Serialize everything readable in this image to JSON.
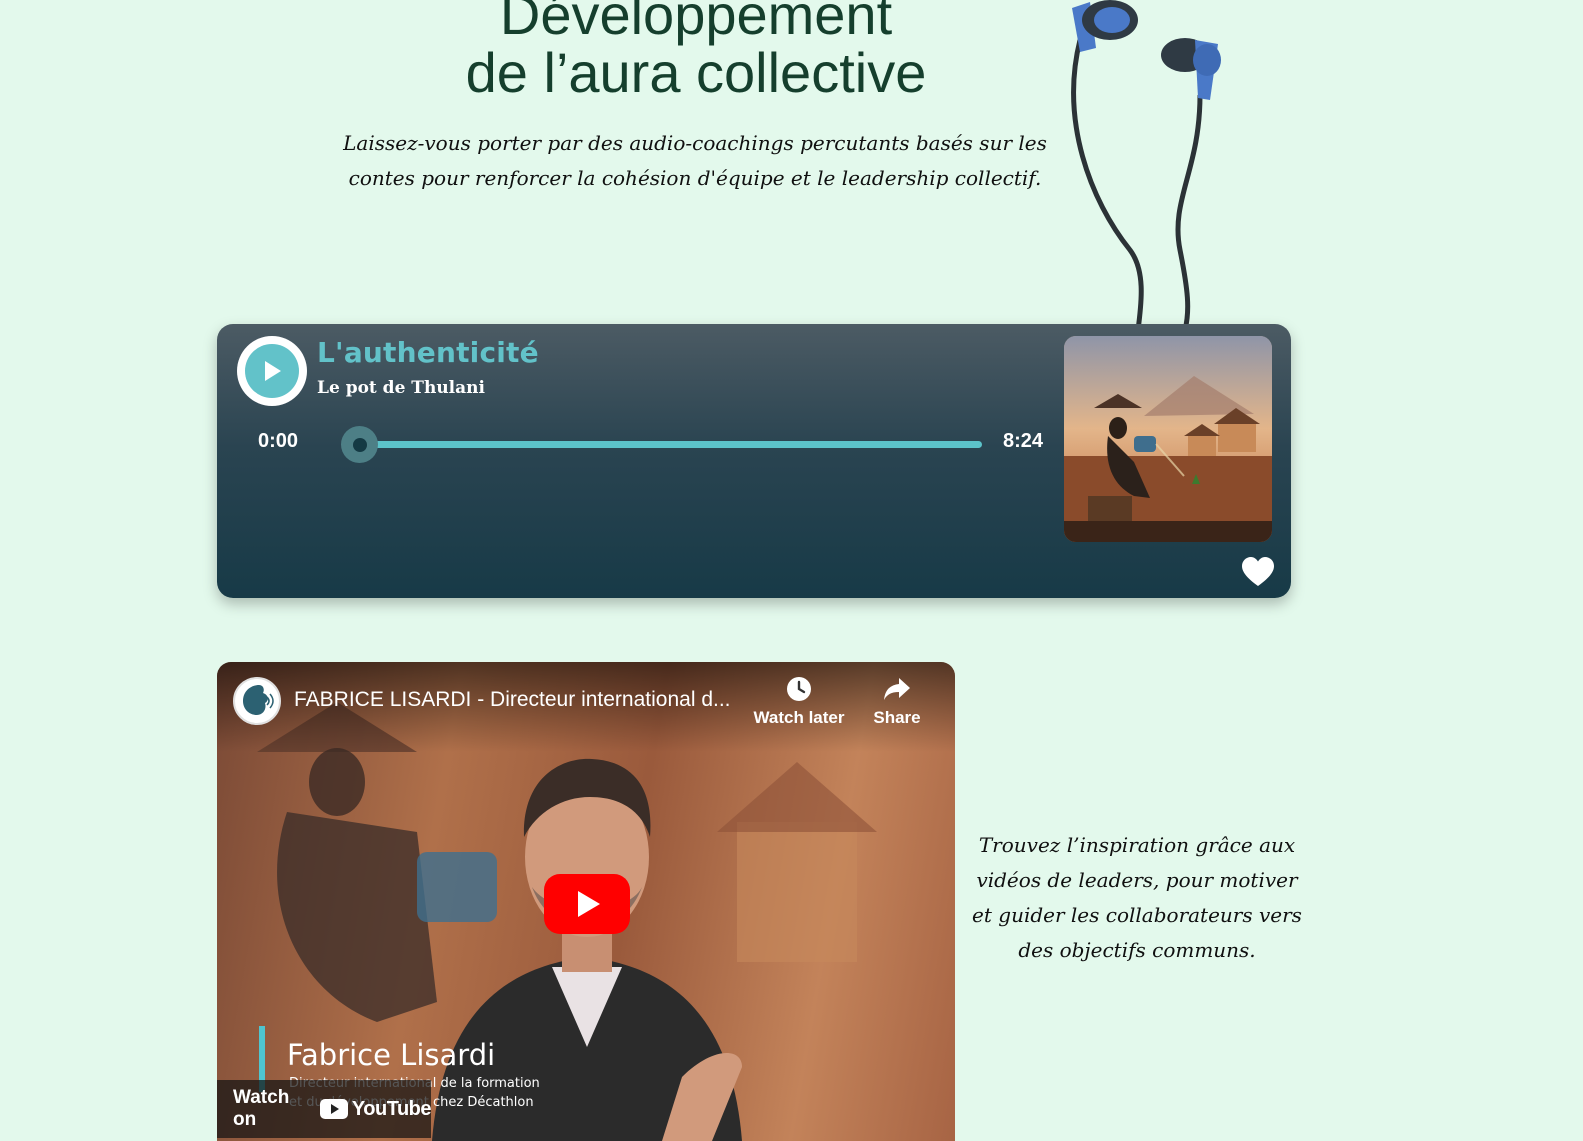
{
  "hero": {
    "title_line1": "Développement",
    "title_line2": "de l’aura collective",
    "subtitle": "Laissez-vous porter par des audio-coachings percutants basés sur les contes pour renforcer la cohésion d'équipe et le leadership collectif."
  },
  "player": {
    "title": "L'authenticité",
    "subtitle": "Le pot de Thulani",
    "time_current": "0:00",
    "time_total": "8:24",
    "progress": 0.0,
    "accent_color": "#62c2c9",
    "play_icon": "play-icon",
    "favorite_icon": "heart-icon"
  },
  "video": {
    "title": "FABRICE LISARDI - Directeur international d...",
    "watch_later_label": "Watch later",
    "share_label": "Share",
    "person_name": "Fabrice Lisardi",
    "person_role_line1": "Directeur international de la formation",
    "person_role_line2": "et du développement chez Décathlon",
    "watch_on_label": "Watch on",
    "youtube_label": "YouTube",
    "youtube_red": "#ff0000"
  },
  "side": {
    "text": "Trouvez l’inspiration grâce aux vidéos de leaders, pour motiver et guider les collaborateurs vers des objectifs communs."
  }
}
